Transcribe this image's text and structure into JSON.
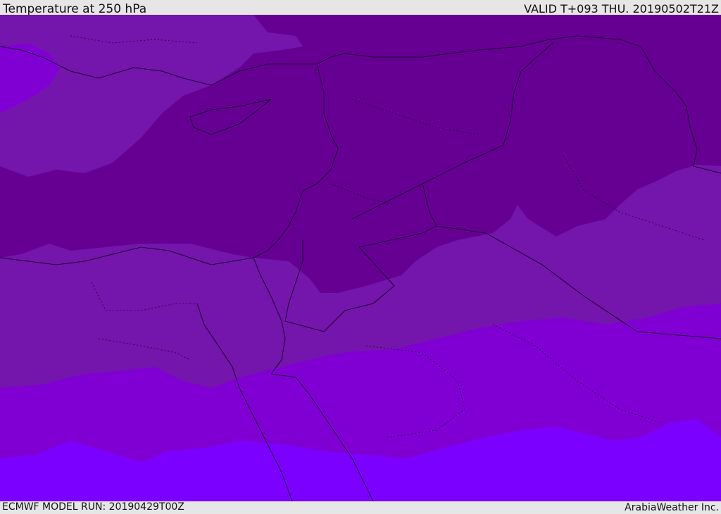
{
  "header": {
    "title": "Temperature at 250 hPa",
    "valid_time": "VALID T+093 THU. 20190502T21Z"
  },
  "footer": {
    "model_run": "ECMWF MODEL RUN: 20190429T00Z",
    "credit": "ArabiaWeather Inc."
  },
  "map": {
    "colors": {
      "darkest_band": "#650093",
      "dark_band": "#7415ac",
      "mid_band": "#8000d4",
      "light_band": "#8300f7",
      "lightest_band": "#7b00ff",
      "border_line": "#1a0030"
    }
  }
}
